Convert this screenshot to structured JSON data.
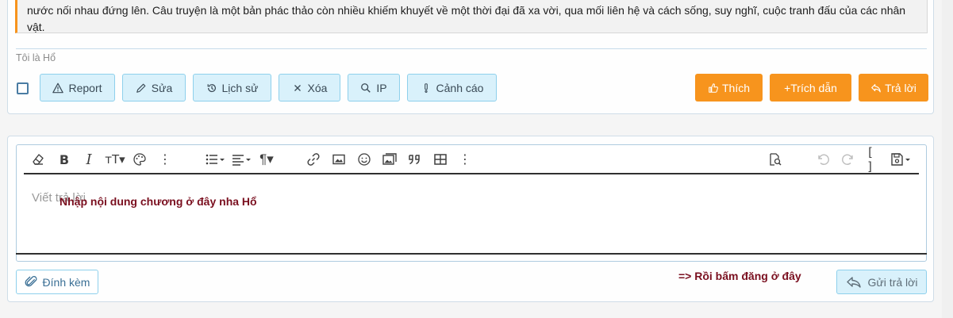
{
  "post": {
    "quote_text": "nước nối nhau đứng lên. Câu truyện là một bản phác thảo còn nhiều khiếm khuyết về một thời đại đã xa vời, qua mối liên hệ và cách sống, suy nghĩ, cuộc tranh đấu của các nhân vật.",
    "signature": "Tôi là Hổ",
    "actions": {
      "report": "Report",
      "edit": "Sửa",
      "history": "Lịch sử",
      "delete": "Xóa",
      "ip": "IP",
      "warn": "Cảnh cáo"
    },
    "reactions": {
      "like": "Thích",
      "quote": "+Trích dẫn",
      "reply": "Trả lời"
    }
  },
  "editor": {
    "placeholder": "Viết trả lời",
    "toolbar_icons": [
      "eraser-icon",
      "bold-icon",
      "italic-icon",
      "text-size-icon",
      "palette-icon",
      "more-icon",
      "list-icon",
      "align-icon",
      "paragraph-icon",
      "link-icon",
      "image-icon",
      "smiley-icon",
      "media-icon",
      "quote-icon",
      "table-icon",
      "more-icon",
      "preview-icon",
      "undo-icon",
      "redo-icon",
      "source-icon",
      "save-icon"
    ],
    "attach_label": "Đính kèm",
    "send_label": "Gửi trả lời"
  },
  "annotations": {
    "hint_content": "Nhập nội dung chương ở đây nha Hổ",
    "hint_send": "=> Rồi bấm đăng ở đây"
  },
  "colors": {
    "accent_orange": "#f7941d",
    "light_button": "#d9f1fb",
    "annotation": "#7a0f1f"
  }
}
